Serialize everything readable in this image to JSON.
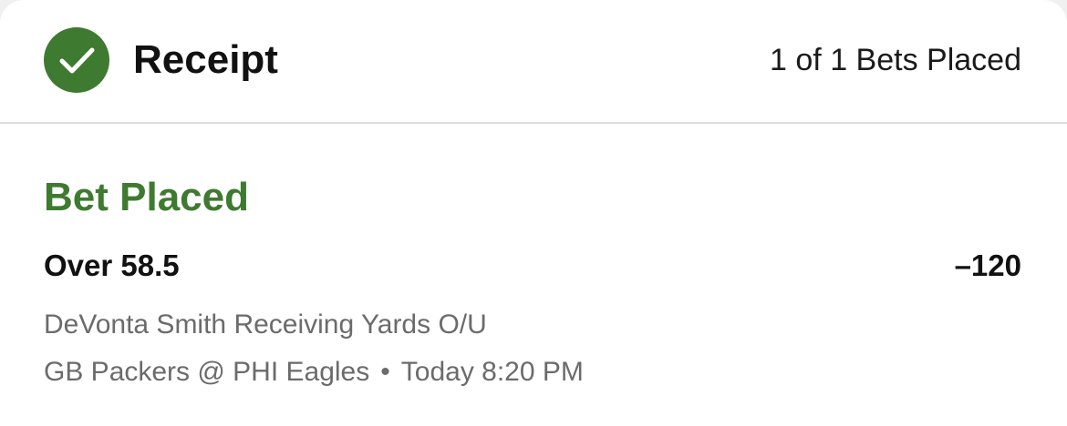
{
  "header": {
    "title": "Receipt",
    "bets_placed": "1 of 1 Bets Placed"
  },
  "bet": {
    "status": "Bet Placed",
    "selection": "Over 58.5",
    "odds": "–120",
    "market": "DeVonta Smith Receiving Yards O/U",
    "event": "GB Packers @ PHI Eagles",
    "separator": "•",
    "time": "Today 8:20 PM"
  },
  "icons": {
    "success": "check-circle-icon"
  },
  "colors": {
    "accent_green": "#3e7a2f",
    "secondary_text": "#6b6b6b"
  }
}
